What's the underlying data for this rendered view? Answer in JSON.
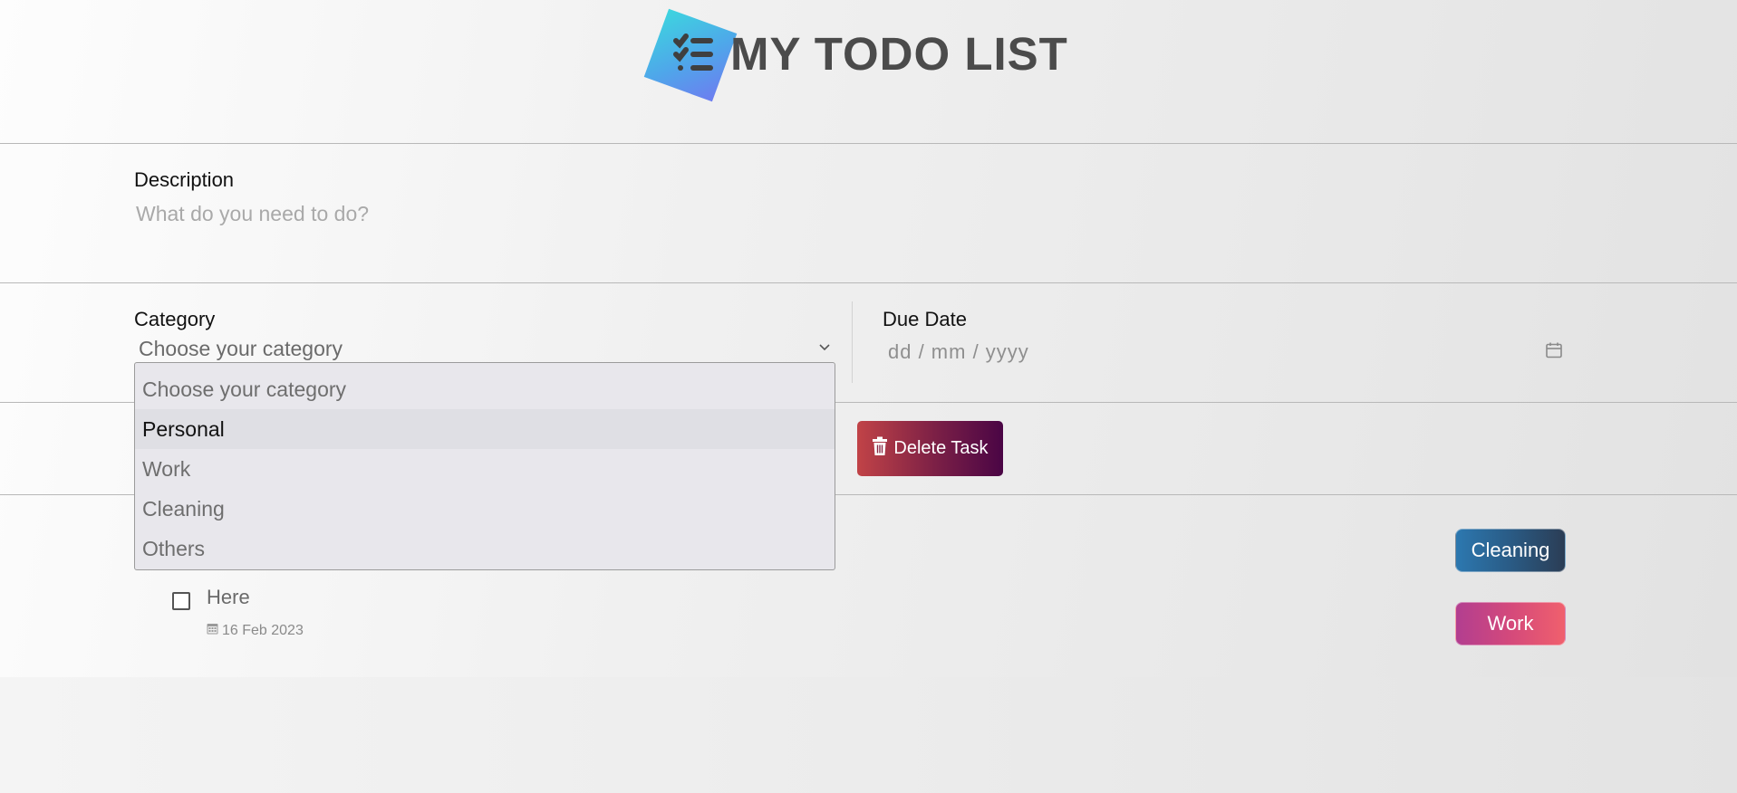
{
  "header": {
    "title": "MY TODO LIST",
    "logo_icon": "checklist-icon",
    "logo_gradient": [
      "#3dd5df",
      "#6d7df0"
    ]
  },
  "description": {
    "label": "Description",
    "placeholder": "What do you need to do?",
    "value": ""
  },
  "category": {
    "label": "Category",
    "selected": "Choose your category",
    "chevron_icon": "chevron-down-icon",
    "dropdown_open": true,
    "options": [
      {
        "label": "Choose your category",
        "highlighted": false
      },
      {
        "label": "Personal",
        "highlighted": true
      },
      {
        "label": "Work",
        "highlighted": false
      },
      {
        "label": "Cleaning",
        "highlighted": false
      },
      {
        "label": "Others",
        "highlighted": false
      }
    ]
  },
  "due_date": {
    "label": "Due Date",
    "placeholder_value": "dd / mm / yyyy",
    "icon": "calendar-icon"
  },
  "actions": {
    "delete_label": "Delete Task",
    "delete_icon": "trash-icon",
    "delete_gradient": [
      "#c14347",
      "#4a0545"
    ]
  },
  "tasks": [
    {
      "title": "",
      "category": "Cleaning",
      "badge_colors": [
        "#2c78b0",
        "#2b3d55"
      ]
    },
    {
      "title": "Here",
      "checked": false,
      "date": "16 Feb 2023",
      "date_icon": "calendar-icon",
      "category": "Work",
      "badge_colors": [
        "#b23e90",
        "#f0606d"
      ]
    }
  ]
}
